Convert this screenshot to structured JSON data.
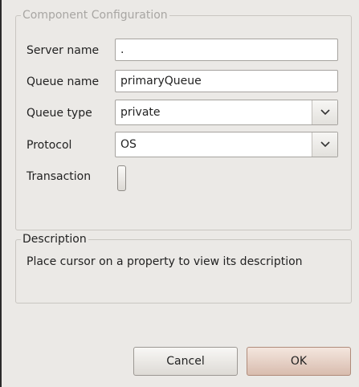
{
  "config": {
    "title": "Component Configuration",
    "server_name_label": "Server name",
    "server_name_value": ".",
    "queue_name_label": "Queue name",
    "queue_name_value": "primaryQueue",
    "queue_type_label": "Queue type",
    "queue_type_value": "private",
    "protocol_label": "Protocol",
    "protocol_value": "OS",
    "transaction_label": "Transaction",
    "transaction_enabled": false
  },
  "description": {
    "title": "Description",
    "text": "Place cursor on a property to view its description"
  },
  "buttons": {
    "cancel_label": "Cancel",
    "ok_label": "OK"
  },
  "icons": {
    "dropdown": "chevron-down-icon"
  },
  "colors": {
    "background": "#ebe9e6",
    "ok_button": "#e6cfc3",
    "group_border": "#c9c6c1"
  }
}
